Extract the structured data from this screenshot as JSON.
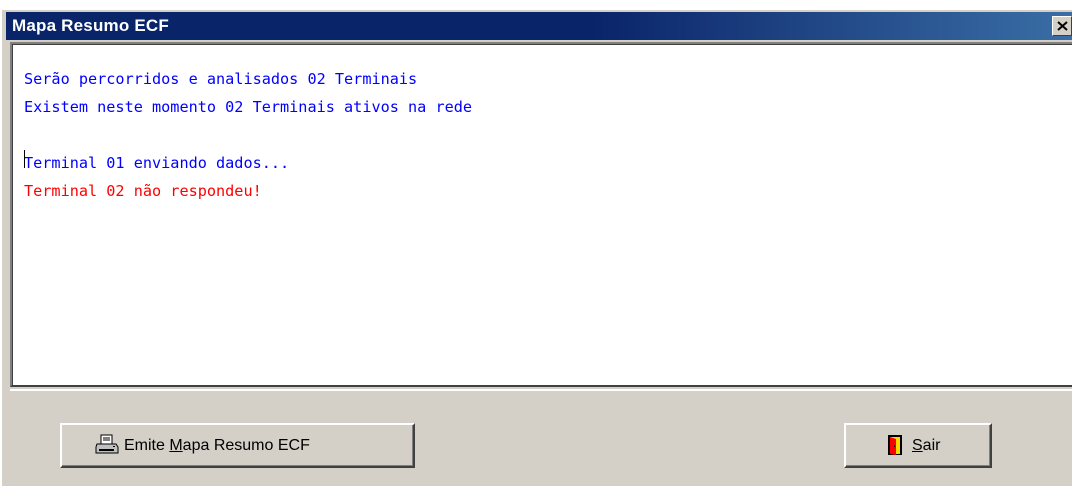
{
  "window": {
    "title": "Mapa Resumo ECF",
    "close_glyph": "✕"
  },
  "log": {
    "lines": [
      {
        "text": "Serão percorridos e analisados 02 Terminais",
        "color": "#0000ff"
      },
      {
        "text": "Existem neste momento 02 Terminais ativos na rede",
        "color": "#0000ff"
      },
      {
        "text": "",
        "color": "#0000ff"
      },
      {
        "text": "Terminal 01 enviando dados...",
        "color": "#0000ff"
      },
      {
        "text": "Terminal 02 não respondeu!",
        "color": "#ff0000"
      }
    ]
  },
  "buttons": {
    "emite": {
      "label_pre": "Emite ",
      "label_accel": "M",
      "label_post": "apa Resumo ECF",
      "icon": "printer-icon"
    },
    "sair": {
      "label_accel": "S",
      "label_post": "air",
      "icon": "exit-door-icon"
    }
  },
  "colors": {
    "title_bar": "#0a246a",
    "info_text": "#0000ff",
    "error_text": "#ff0000",
    "face": "#d4d0c8"
  }
}
